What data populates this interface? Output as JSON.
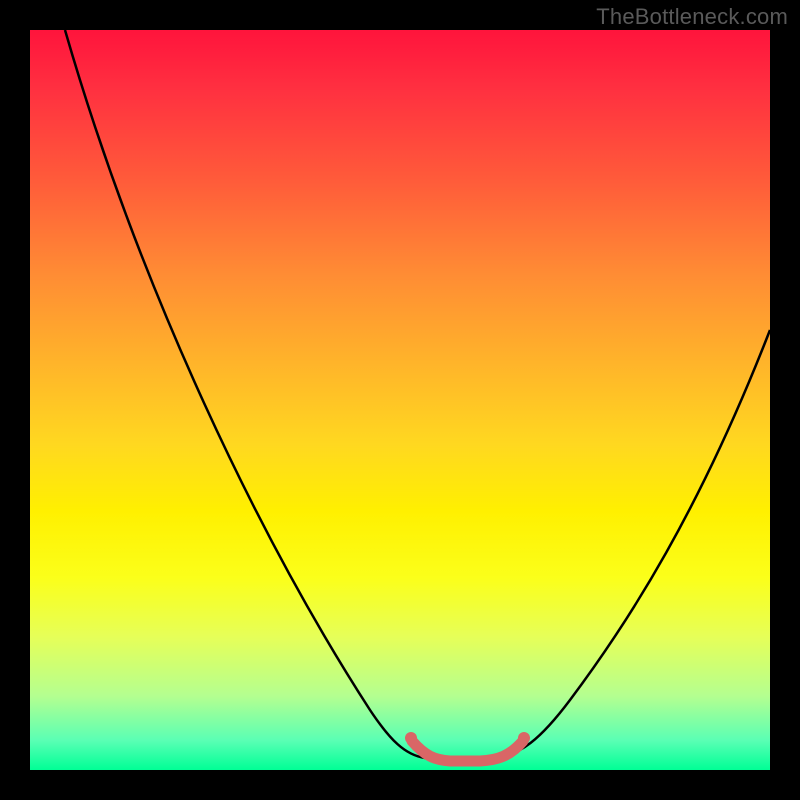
{
  "watermark": "TheBottleneck.com",
  "chart_data": {
    "type": "line",
    "title": "",
    "xlabel": "",
    "ylabel": "",
    "xlim": [
      0,
      100
    ],
    "ylim": [
      0,
      100
    ],
    "grid": false,
    "legend": false,
    "x": [
      5,
      10,
      15,
      20,
      25,
      30,
      35,
      40,
      45,
      48,
      50,
      52,
      54,
      56,
      58,
      60,
      63,
      66,
      70,
      75,
      80,
      85,
      90,
      95,
      100
    ],
    "values": [
      100,
      90,
      80,
      70,
      60,
      50,
      40,
      30,
      20,
      12,
      6,
      2,
      0,
      0,
      0,
      0,
      2,
      5,
      10,
      18,
      27,
      36,
      44,
      52,
      60
    ],
    "annotations": [
      {
        "note": "flat minimum segment",
        "x_start": 52,
        "x_end": 63,
        "y": 0
      }
    ],
    "colors": {
      "curve": "#000000",
      "minimum_highlight": "#d96666",
      "background_top": "#ff143c",
      "background_bottom": "#00ff96"
    }
  }
}
